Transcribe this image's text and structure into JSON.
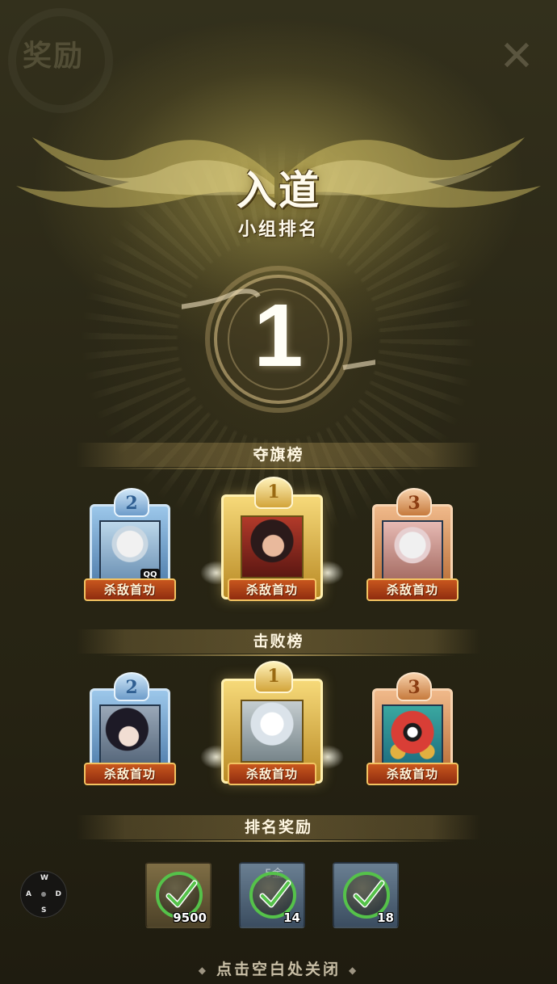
{
  "header": {
    "title": "奖励",
    "close_icon": "close-icon"
  },
  "rank": {
    "name": "入道",
    "subtitle": "小组排名",
    "number": "1"
  },
  "sections": {
    "flag_board": "夺旗榜",
    "defeat_board": "击败榜",
    "rank_rewards": "排名奖励"
  },
  "flag_board": [
    {
      "rank": "2",
      "badge": "杀敌首功",
      "overlay": "QQ"
    },
    {
      "rank": "1",
      "badge": "杀敌首功"
    },
    {
      "rank": "3",
      "badge": "杀敌首功"
    }
  ],
  "defeat_board": [
    {
      "rank": "2",
      "badge": "杀敌首功"
    },
    {
      "rank": "1",
      "badge": "杀敌首功"
    },
    {
      "rank": "3",
      "badge": "杀敌首功"
    }
  ],
  "rewards": [
    {
      "quantity": "9500",
      "claimed": true,
      "tag": ""
    },
    {
      "quantity": "14",
      "claimed": true,
      "tag": "5金"
    },
    {
      "quantity": "18",
      "claimed": true,
      "tag": ""
    }
  ],
  "joystick": {
    "up": "W",
    "left": "A",
    "right": "D",
    "down": "S"
  },
  "footer": {
    "hint": "点击空白处关闭"
  },
  "colors": {
    "check": "#55c24a",
    "ribbon": "#b1431a",
    "gold": "#e8c45a",
    "silver_blue": "#7fa9d3",
    "bronze": "#d58a4c"
  }
}
